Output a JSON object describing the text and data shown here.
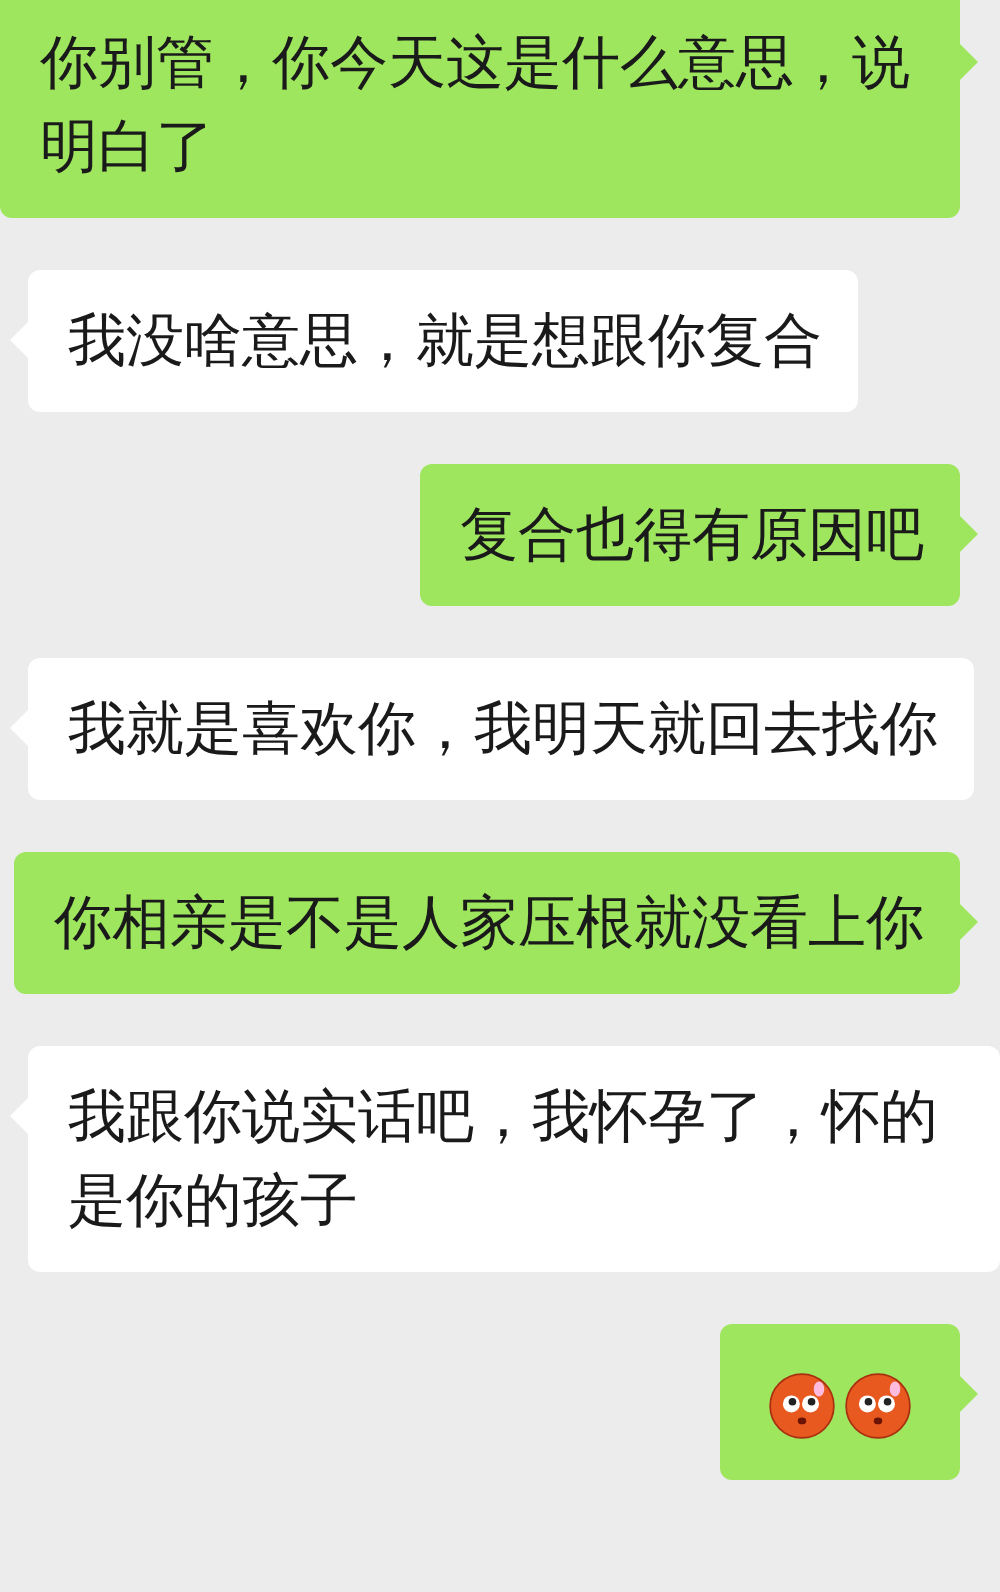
{
  "messages": [
    {
      "kind": "sent",
      "text": "你别管，你今天这是什么意思，说明白了"
    },
    {
      "kind": "received",
      "text": "我没啥意思，就是想跟你复合"
    },
    {
      "kind": "sent",
      "text": "复合也得有原因吧"
    },
    {
      "kind": "received",
      "text": "我就是喜欢你，我明天就回去找你"
    },
    {
      "kind": "sent",
      "text": "你相亲是不是人家压根就没看上你"
    },
    {
      "kind": "received",
      "text": "我跟你说实话吧，我怀孕了，怀的是你的孩子"
    },
    {
      "kind": "sent",
      "emojis": [
        {
          "kind": "flushed"
        },
        {
          "kind": "flushed"
        }
      ]
    }
  ]
}
